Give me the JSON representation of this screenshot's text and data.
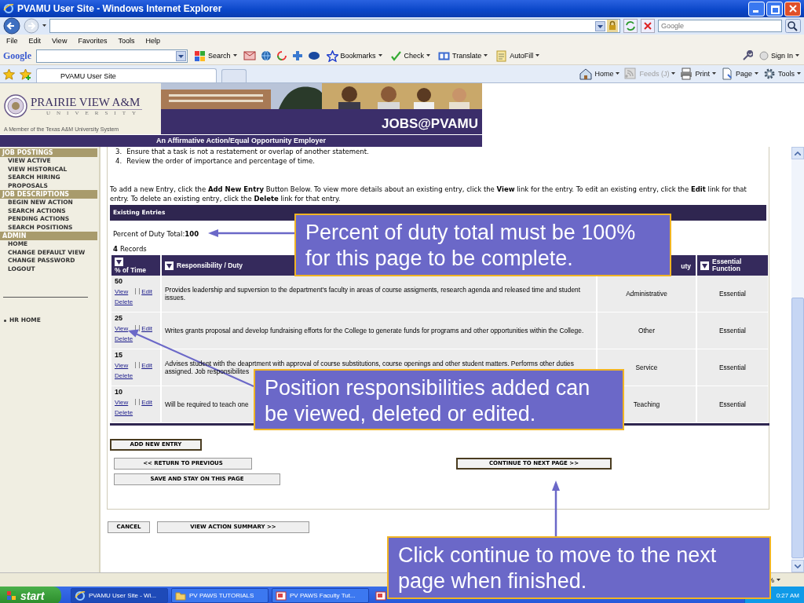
{
  "window": {
    "title": "PVAMU User Site - Windows Internet Explorer"
  },
  "address_bar": {
    "search_placeholder": "Google"
  },
  "menu": [
    "File",
    "Edit",
    "View",
    "Favorites",
    "Tools",
    "Help"
  ],
  "google_toolbar": {
    "logo": "Google",
    "items": [
      {
        "label": "Search"
      },
      {
        "label": "Bookmarks"
      },
      {
        "label": "Check"
      },
      {
        "label": "Translate"
      },
      {
        "label": "AutoFill"
      }
    ],
    "sign_in": "Sign In"
  },
  "tab": {
    "label": "PVAMU User Site",
    "selected": true
  },
  "command_bar": [
    {
      "label": "Home",
      "disabled": false
    },
    {
      "label": "Feeds (J)",
      "disabled": true
    },
    {
      "label": "Print",
      "disabled": false
    },
    {
      "label": "Page",
      "disabled": false
    },
    {
      "label": "Tools",
      "disabled": false
    }
  ],
  "header": {
    "university": "PRAIRIE VIEW A&M",
    "university_sub": "UNIVERSITY",
    "member_line": "A Member of the Texas A&M University System",
    "site_title": "JOBS@PVAMU",
    "tagline": "An Affirmative Action/Equal Opportunity Employer"
  },
  "sidebar": {
    "sections": [
      {
        "title": "JOB POSTINGS",
        "items": [
          "VIEW ACTIVE",
          "VIEW HISTORICAL",
          "SEARCH HIRING PROPOSALS"
        ]
      },
      {
        "title": "JOB DESCRIPTIONS",
        "items": [
          "BEGIN NEW ACTION",
          "SEARCH ACTIONS",
          "PENDING ACTIONS",
          "SEARCH POSITIONS"
        ]
      },
      {
        "title": "ADMIN",
        "items": [
          "HOME",
          "CHANGE DEFAULT VIEW",
          "CHANGE PASSWORD",
          "LOGOUT"
        ]
      }
    ],
    "links": [
      "HR HOME"
    ]
  },
  "content": {
    "steps": [
      {
        "number": "3.",
        "text": "Ensure that a task is not a restatement or overlap of another statement."
      },
      {
        "number": "4.",
        "text": "Review the order of importance and percentage of time."
      }
    ],
    "instructions": "To add a new Entry, click the **Add New Entry** Button Below. To view more details about an existing entry, click the **View** link for the entry. To edit an existing entry, click the **Edit** link for that entry. To delete an existing entry, click the **Delete** link for that entry.",
    "panel_title": "Existing Entries",
    "total_label": "Percent of Duty Total:",
    "total_value": "100",
    "record_count": "4",
    "record_label": "Records",
    "table": {
      "columns": [
        "% of Time",
        "Responsibility / Duty",
        "uty",
        "Essential Function"
      ],
      "rows": [
        {
          "percent": "50",
          "view": "View",
          "edit": "Edit",
          "delete": "Delete",
          "description": "Provides leadership and supversion to the department's faculty in areas of course assigments, research agenda and released time and student issues.",
          "duty": "Administrative",
          "essential": "Essential"
        },
        {
          "percent": "25",
          "view": "View",
          "edit": "Edit",
          "delete": "Delete",
          "description": "Writes grants proposal and develop fundraising efforts for the College to generate funds for programs and other opportunities within the College.",
          "duty": "Other",
          "essential": "Essential"
        },
        {
          "percent": "15",
          "view": "View",
          "edit": "Edit",
          "delete": "Delete",
          "description": "Advises student with the deaprtment with approval of course substitutions, course openings and other student matters. Performs other duties assigned. Job responsibilites",
          "duty": "Service",
          "essential": "Essential"
        },
        {
          "percent": "10",
          "view": "View",
          "edit": "Edit",
          "delete": "Delete",
          "description": "Will be required to teach one",
          "duty": "Teaching",
          "essential": "Essential"
        }
      ]
    },
    "add_button": {
      "label": "ADD NEW ENTRY",
      "highlighted": true
    },
    "nav_buttons": [
      {
        "label": "<< RETURN TO PREVIOUS",
        "highlighted": false
      },
      {
        "label": "SAVE AND STAY ON THIS PAGE",
        "highlighted": false
      }
    ],
    "continue_button": {
      "label": "CONTINUE TO NEXT PAGE >>",
      "highlighted": true
    },
    "bottom_buttons": [
      {
        "label": "CANCEL",
        "highlighted": false
      },
      {
        "label": "VIEW ACTION SUMMARY >>",
        "highlighted": false
      }
    ]
  },
  "status_bar": {
    "zoom": "%"
  },
  "taskbar": {
    "start": "start",
    "items": [
      {
        "label": "PVAMU User Site - Wi...",
        "selected": true
      },
      {
        "label": "PV PAWS TUTORIALS",
        "selected": false
      },
      {
        "label": "PV PAWS Faculty Tut...",
        "selected": false
      }
    ],
    "clock": "0:27 AM"
  },
  "callouts": [
    {
      "text": "Percent of duty total must be 100% for this page to be complete."
    },
    {
      "text": "Position responsibilities added can be viewed, deleted or edited."
    },
    {
      "text": "Click continue to move to the next page when finished."
    }
  ]
}
